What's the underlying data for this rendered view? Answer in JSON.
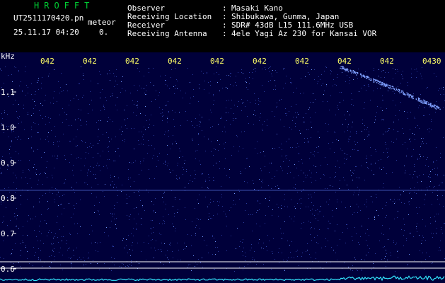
{
  "app": {
    "title": "HROFFT"
  },
  "file": {
    "name": "UT2511170420.pn",
    "mode": "meteor",
    "timestamp": "25.11.17 04:20",
    "count": "0."
  },
  "info": {
    "labels": [
      "Observer",
      "Receiving Location",
      "Receiver",
      "Receiving Antenna"
    ],
    "separator": ":",
    "values": [
      "Masaki Kano",
      "Shibukawa, Gunma, Japan",
      "SDR# 43dB L15 111.6MHz USB",
      "4ele Yagi Az 230 for Kansai VOR"
    ]
  },
  "spectrogram": {
    "unit_label": "kHz",
    "y_ticks": [
      "1.1",
      "1.0",
      "0.9",
      "0.8",
      "0.7",
      "0.6"
    ],
    "time_labels": [
      "042",
      "042",
      "042",
      "042",
      "042",
      "042",
      "042",
      "042",
      "042",
      "0430"
    ],
    "colors": {
      "background": "#00003a",
      "noise": "#2a3aa0",
      "signal": "#6a8cff",
      "trace": "#33e6ff",
      "time": "#ffff66",
      "hline": "#ffffff"
    }
  }
}
